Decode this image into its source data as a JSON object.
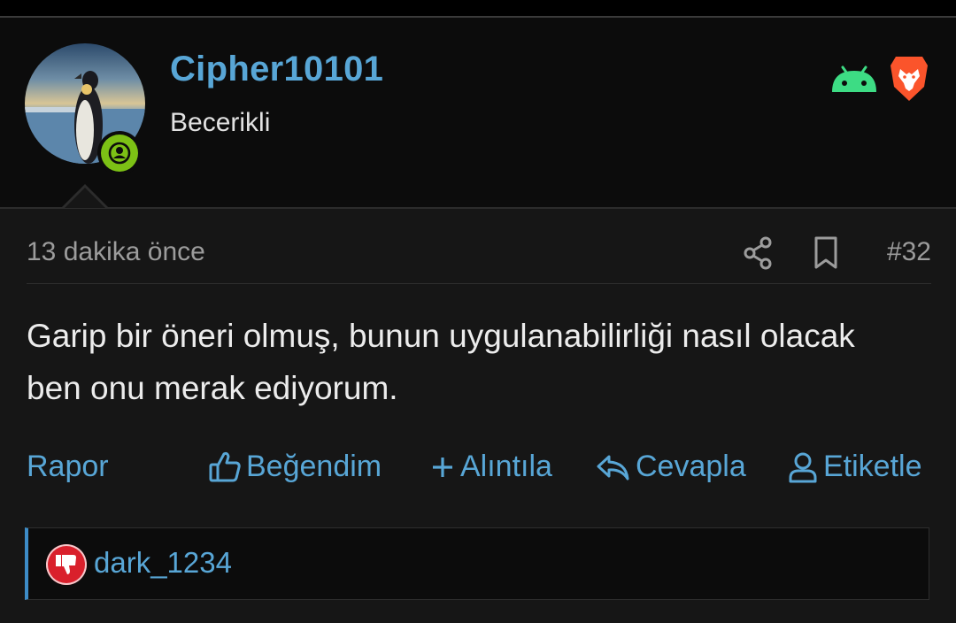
{
  "post": {
    "author": {
      "username": "Cipher10101",
      "title": "Becerikli"
    },
    "platform_icons": [
      "android-icon",
      "brave-icon"
    ],
    "timestamp": "13 dakika önce",
    "post_number": "#32",
    "message": "Garip bir öneri olmuş, bunun uygulanabilirliği nasıl olacak ben onu merak ediyorum.",
    "actions": {
      "report": "Rapor",
      "like": "Beğendim",
      "quote": "Alıntıla",
      "reply": "Cevapla",
      "mention": "Etiketle"
    },
    "reactions": {
      "icon": "dislike-icon",
      "user": "dark_1234"
    }
  },
  "colors": {
    "accent": "#58a6d6",
    "online": "#7cc115",
    "android": "#3ddc84",
    "brave": "#fb542b",
    "dislike": "#d9202c"
  }
}
